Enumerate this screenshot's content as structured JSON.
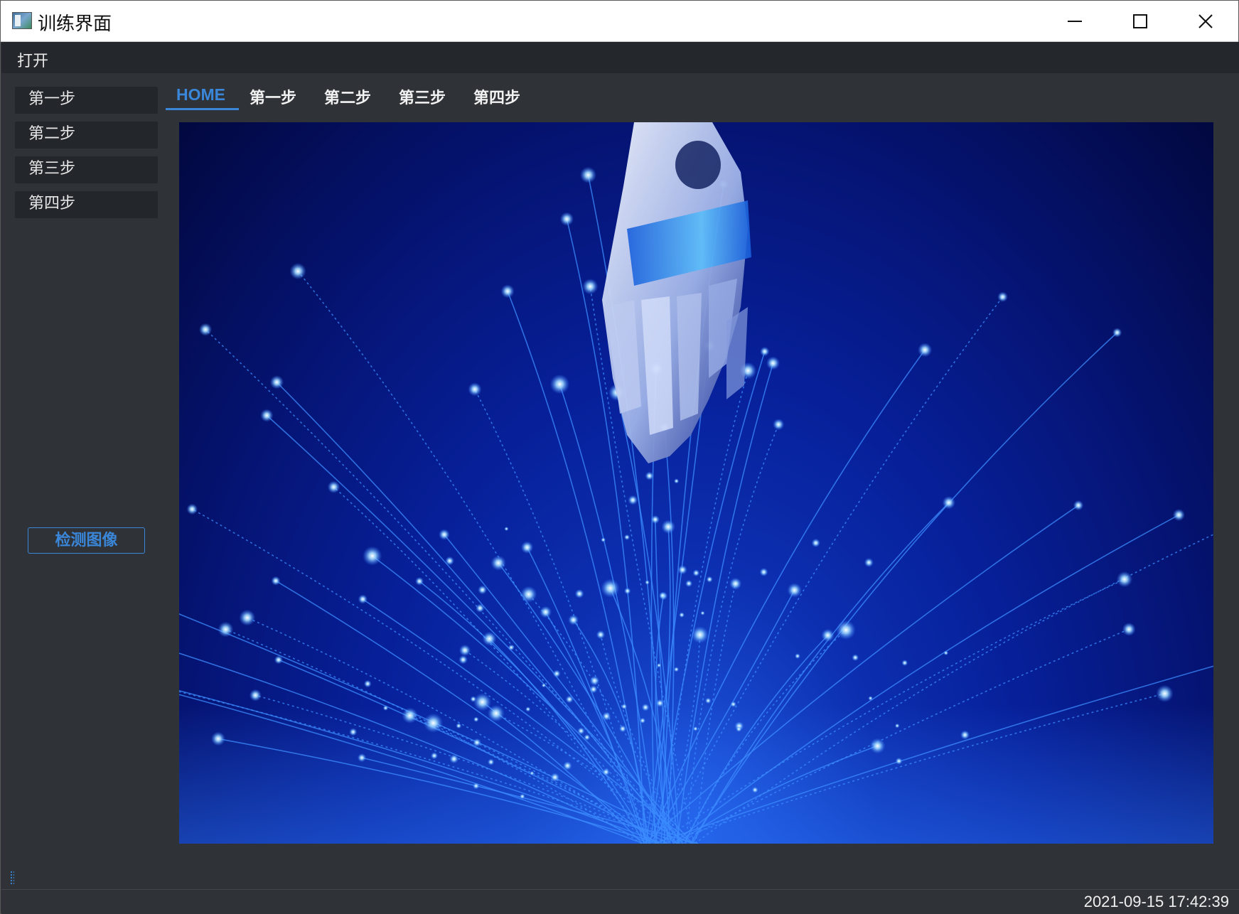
{
  "window": {
    "title": "训练界面",
    "minimize_icon": "minimize-icon",
    "maximize_icon": "maximize-icon",
    "close_icon": "close-icon"
  },
  "menu": {
    "items": [
      {
        "label": "打开"
      }
    ]
  },
  "sidebar": {
    "items": [
      {
        "label": "第一步"
      },
      {
        "label": "第二步"
      },
      {
        "label": "第三步"
      },
      {
        "label": "第四步"
      }
    ],
    "detect_button": "检测图像"
  },
  "tabs": {
    "items": [
      {
        "label": "HOME",
        "active": true
      },
      {
        "label": "第一步",
        "active": false
      },
      {
        "label": "第二步",
        "active": false
      },
      {
        "label": "第三步",
        "active": false
      },
      {
        "label": "第四步",
        "active": false
      }
    ]
  },
  "status": {
    "datetime": "2021-09-15 17:42:39"
  },
  "colors": {
    "accent": "#3a86d8",
    "background": "#2f3338",
    "menu_background": "#24272b",
    "image_dark": "#02083f",
    "image_bright": "#1f58e0"
  }
}
